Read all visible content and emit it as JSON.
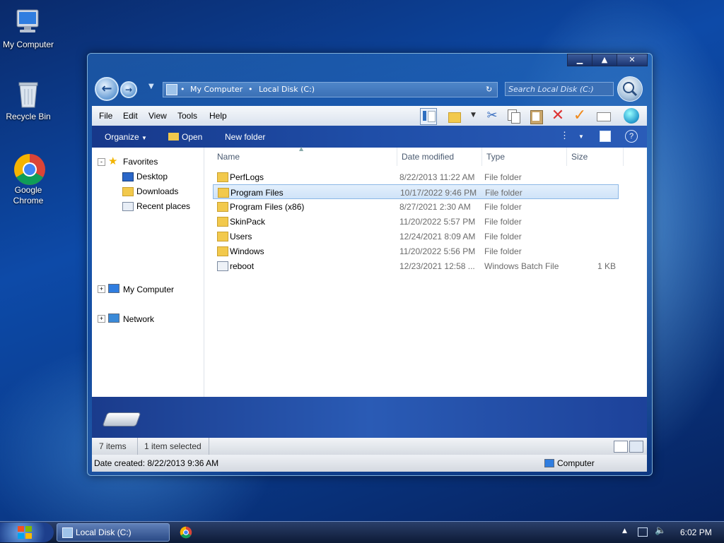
{
  "desktop": {
    "icons": [
      {
        "label": "My Computer"
      },
      {
        "label": "Recycle Bin"
      },
      {
        "label": "Google\nChrome"
      }
    ]
  },
  "window": {
    "title_buttons": {
      "minimize": "▁",
      "maximize": "▲",
      "close": "✕"
    },
    "address": {
      "segment1": "My Computer",
      "segment2": "Local Disk (C:)"
    },
    "search_placeholder": "Search Local Disk (C:)",
    "menu": [
      "File",
      "Edit",
      "View",
      "Tools",
      "Help"
    ],
    "commands": {
      "organize": "Organize",
      "open": "Open",
      "new_folder": "New folder"
    },
    "nav": {
      "favorites": "Favorites",
      "desktop": "Desktop",
      "downloads": "Downloads",
      "recent": "Recent places",
      "my_computer": "My Computer",
      "network": "Network"
    },
    "columns": {
      "name": "Name",
      "date": "Date modified",
      "type": "Type",
      "size": "Size"
    },
    "files": [
      {
        "name": "PerfLogs",
        "date": "8/22/2013 11:22 AM",
        "type": "File folder",
        "size": ""
      },
      {
        "name": "Program Files",
        "date": "10/17/2022 9:46 PM",
        "type": "File folder",
        "size": ""
      },
      {
        "name": "Program Files (x86)",
        "date": "8/27/2021 2:30 AM",
        "type": "File folder",
        "size": ""
      },
      {
        "name": "SkinPack",
        "date": "11/20/2022 5:57 PM",
        "type": "File folder",
        "size": ""
      },
      {
        "name": "Users",
        "date": "12/24/2021 8:09 AM",
        "type": "File folder",
        "size": ""
      },
      {
        "name": "Windows",
        "date": "11/20/2022 5:56 PM",
        "type": "File folder",
        "size": ""
      },
      {
        "name": "reboot",
        "date": "12/23/2021 12:58 ...",
        "type": "Windows Batch File",
        "size": "1 KB"
      }
    ],
    "selected_index": 1,
    "status": {
      "items": "7 items",
      "selected": "1 item selected"
    },
    "status2": {
      "date_created": "Date created: 8/22/2013 9:36 AM",
      "location": "Computer"
    }
  },
  "taskbar": {
    "task_label": "Local Disk (C:)",
    "clock": "6:02 PM"
  },
  "colors": {
    "accent": "#1f4ea8",
    "selection": "#cfe3f8",
    "folder": "#f2c94c"
  }
}
